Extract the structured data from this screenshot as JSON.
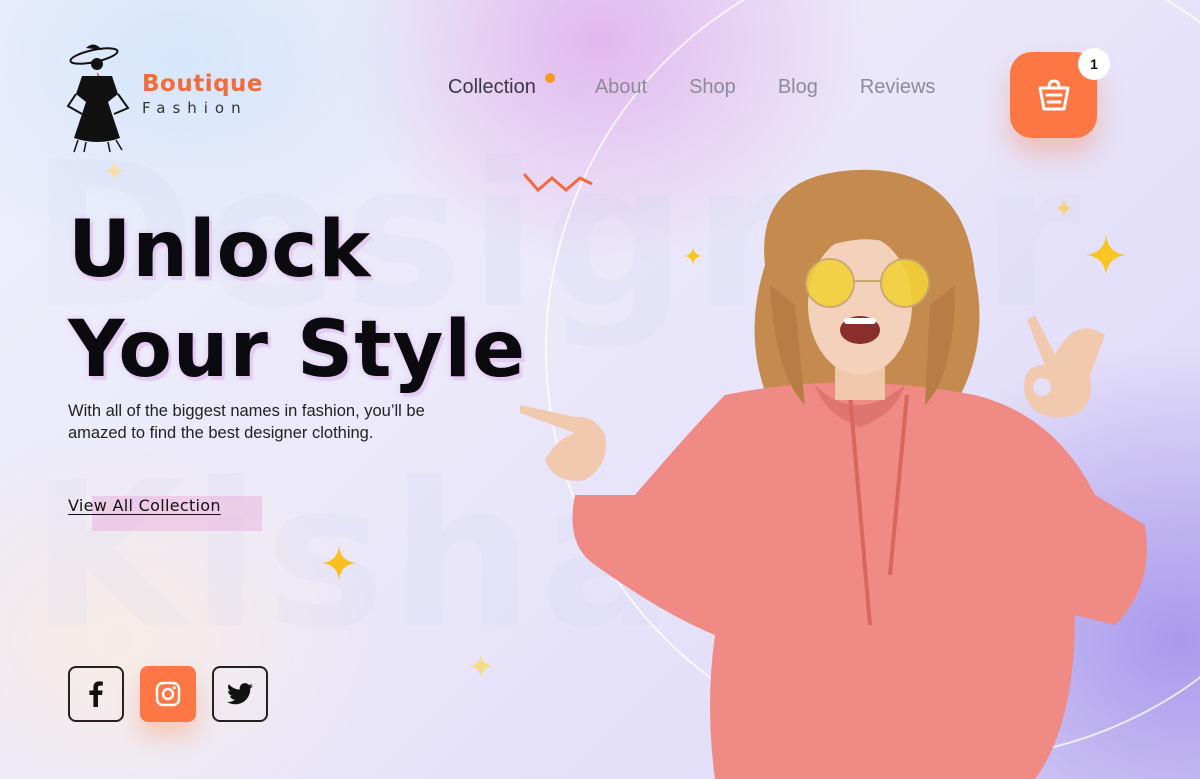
{
  "brand": {
    "name": "Boutique",
    "tagline": "Fashion",
    "accent_color": "#f26b3a"
  },
  "nav": {
    "items": [
      {
        "label": "Collection",
        "active": true
      },
      {
        "label": "About",
        "active": false
      },
      {
        "label": "Shop",
        "active": false
      },
      {
        "label": "Blog",
        "active": false
      },
      {
        "label": "Reviews",
        "active": false
      }
    ],
    "active_indicator_color": "#f59a1b"
  },
  "cart": {
    "icon": "shopping-basket-icon",
    "count": "1",
    "color": "#fd7744"
  },
  "watermark": {
    "top": "Designer",
    "bottom": "Kisha"
  },
  "hero": {
    "title_line1": "Unlock",
    "title_line2": "Your Style",
    "description": "With all of the biggest names in fashion, you’ll be amazed to find the best designer clothing.",
    "cta_label": "View All Collection"
  },
  "social": [
    {
      "name": "facebook",
      "icon": "facebook-icon",
      "highlighted": false
    },
    {
      "name": "instagram",
      "icon": "instagram-icon",
      "highlighted": true
    },
    {
      "name": "twitter",
      "icon": "twitter-icon",
      "highlighted": false
    }
  ],
  "model_photo": {
    "description": "Smiling woman with curly hair, yellow round sunglasses and pink hoodie pointing left and making OK gesture",
    "hoodie_color": "#f08a84"
  }
}
